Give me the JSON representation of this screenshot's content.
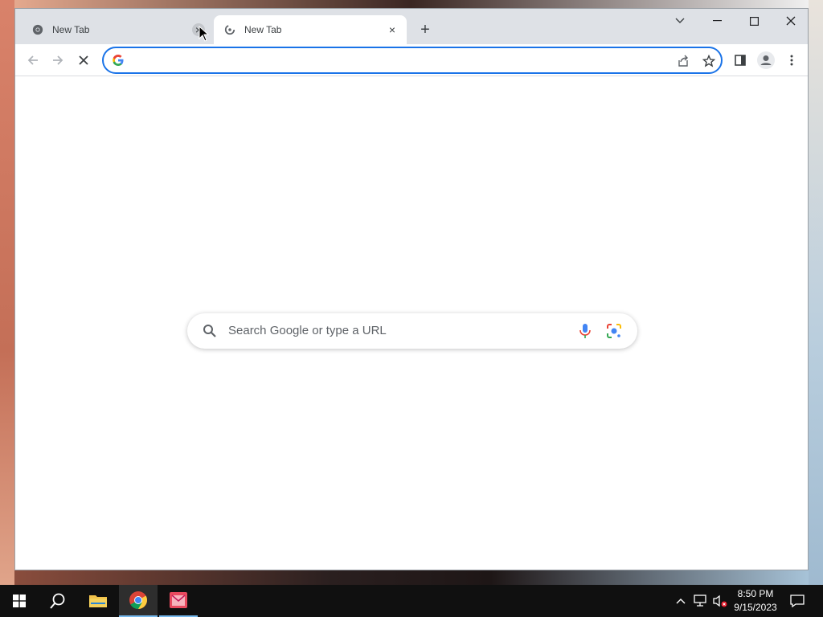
{
  "browser": {
    "tabs": [
      {
        "title": "New Tab",
        "active": false,
        "favicon": "chrome-icon"
      },
      {
        "title": "New Tab",
        "active": true,
        "favicon": "loading-icon"
      }
    ],
    "new_tab_icon": "plus-icon",
    "window_controls": [
      "tab-search-icon",
      "minimize-icon",
      "maximize-icon",
      "close-icon"
    ],
    "toolbar": {
      "back_icon": "arrow-left-icon",
      "forward_icon": "arrow-right-icon",
      "stop_icon": "stop-icon",
      "omnibox_value": "",
      "omnibox_icon": "google-g-icon",
      "share_icon": "share-icon",
      "bookmark_icon": "star-icon",
      "side_panel_icon": "side-panel-icon",
      "profile_icon": "profile-icon",
      "menu_icon": "kebab-menu-icon"
    },
    "accent_color": "#1a73e8"
  },
  "newtab": {
    "search_placeholder": "Search Google or type a URL",
    "icons": [
      "search-icon",
      "mic-icon",
      "google-lens-icon"
    ]
  },
  "taskbar": {
    "apps": [
      "windows-start-icon",
      "search-icon",
      "file-explorer-icon",
      "chrome-icon",
      "app-icon"
    ],
    "tray_icons": [
      "chevron-up-icon",
      "network-icon",
      "volume-muted-icon",
      "notification-icon"
    ],
    "time": "8:50 PM",
    "date": "9/15/2023"
  }
}
